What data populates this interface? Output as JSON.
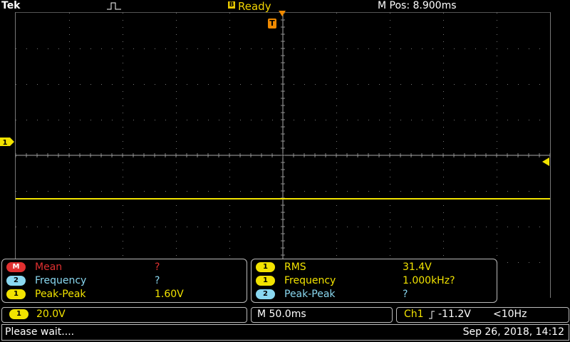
{
  "header": {
    "brand": "Tek",
    "acq_badge": "B",
    "status": "Ready",
    "mpos": "M Pos: 8.900ms"
  },
  "screen": {
    "trigger_marker": "T",
    "ch1_marker": "1",
    "trace_color": "#f2e300"
  },
  "measurements_left": [
    {
      "badge": "M",
      "label": "Mean",
      "value": "?",
      "color": "#e03030"
    },
    {
      "badge": "2",
      "label": "Frequency",
      "value": "?",
      "color": "#8ad8f0"
    },
    {
      "badge": "1",
      "label": "Peak-Peak",
      "value": "1.60V",
      "color": "#f2e300"
    }
  ],
  "measurements_right": [
    {
      "badge": "1",
      "label": "RMS",
      "value": "31.4V",
      "color": "#f2e300"
    },
    {
      "badge": "1",
      "label": "Frequency",
      "value": "1.000kHz?",
      "color": "#f2e300"
    },
    {
      "badge": "2",
      "label": "Peak-Peak",
      "value": "?",
      "color": "#8ad8f0"
    }
  ],
  "bottom": {
    "ch_badge": "1",
    "ch_scale": "20.0V",
    "time_scale": "M 50.0ms",
    "trig_channel": "Ch1",
    "trig_level": "-11.2V",
    "trig_freq": "<10Hz"
  },
  "message": {
    "text": "Please wait....",
    "datetime": "Sep 26, 2018, 14:12"
  }
}
